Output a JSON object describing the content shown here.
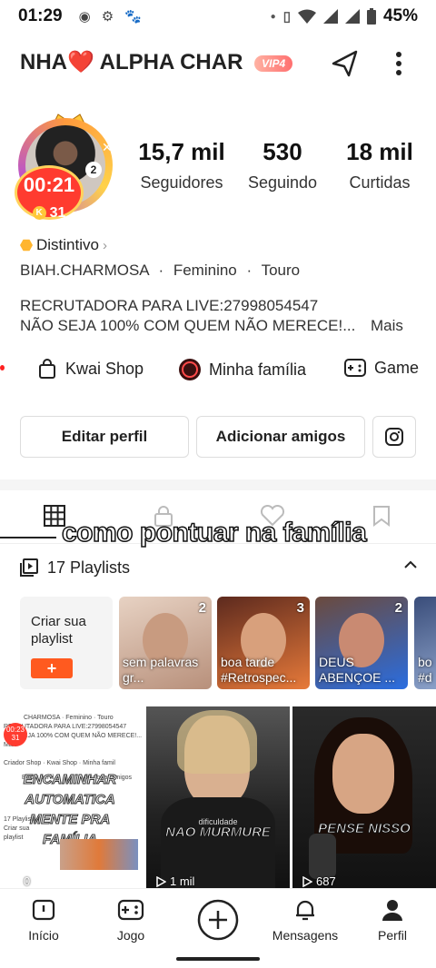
{
  "status_bar": {
    "time": "01:29",
    "battery": "45%"
  },
  "header": {
    "name": "NHA❤️ ALPHA CHAR",
    "vip": "VIP4"
  },
  "profile": {
    "timer": "00:21",
    "coins": "31",
    "coin_badge": "K",
    "notif_count": "2",
    "stats": [
      {
        "value": "15,7 mil",
        "label": "Seguidores"
      },
      {
        "value": "530",
        "label": "Seguindo"
      },
      {
        "value": "18 mil",
        "label": "Curtidas"
      }
    ],
    "distintivo": "Distintivo",
    "username": "BIAH.CHARMOSA",
    "gender": "Feminino",
    "sign": "Touro",
    "separator": "·",
    "bio_line1": "RECRUTADORA PARA LIVE:27998054547",
    "bio_line2": "NÃO SEJA 100% COM QUEM NÃO MERECE!...",
    "bio_more": "Mais"
  },
  "links": {
    "shop": "Kwai Shop",
    "family": "Minha família",
    "game": "Game"
  },
  "buttons": {
    "edit": "Editar perfil",
    "add_friends": "Adicionar amigos"
  },
  "overlay_caption": "como pontuar na família",
  "playlists": {
    "title": "17 Playlists",
    "create": "Criar sua playlist",
    "create_plus": "+",
    "items": [
      {
        "count": "2",
        "caption": "sem palavras gr..."
      },
      {
        "count": "3",
        "caption": "boa tarde #Retrospec..."
      },
      {
        "count": "2",
        "caption": "DEUS ABENÇOE ..."
      },
      {
        "count": "",
        "caption": "bo #d"
      }
    ]
  },
  "videos": [
    {
      "caption": "ENCAMINHAR AUTOMATICA MENTE PRA FAMÍLIA",
      "views": "0"
    },
    {
      "caption": "NAO MURMURE",
      "subcaption": "dificuldade",
      "views": "1 mil"
    },
    {
      "caption": "PENSE NISSO",
      "views": "687"
    }
  ],
  "video1_shot": {
    "header": "CHARMOSA · Feminino · Touro",
    "bio1": "RECRUTADORA PARA LIVE:27998054547",
    "bio2": "NÃO SEJA 100% COM QUEM NÃO MERECE!... Mais",
    "links": "Criador Shop · Kwai Shop · Minha famil",
    "edit": "Editar perfil",
    "add": "Adicionar amigos",
    "playlists": "17 Playlists",
    "create": "Criar sua playlist",
    "timer": "00:23",
    "coins": "31"
  },
  "nav": {
    "home": "Início",
    "game": "Jogo",
    "messages": "Mensagens",
    "profile": "Perfil"
  },
  "colors": {
    "accent": "#ff5a1f",
    "live": "#ff3b2f",
    "vip": "#ff7a6b"
  }
}
